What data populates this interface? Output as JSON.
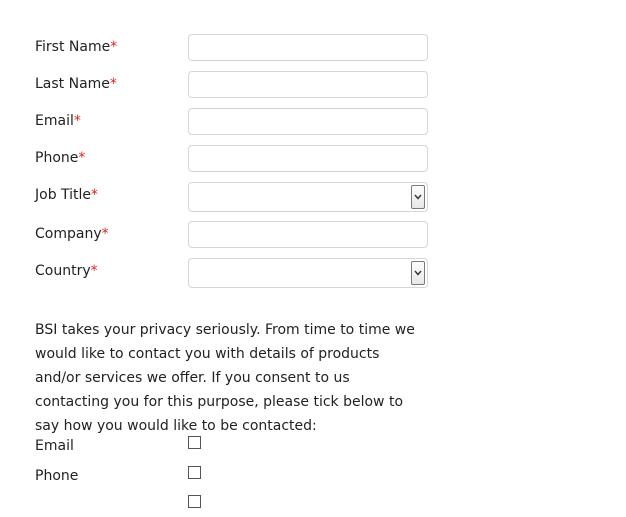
{
  "form": {
    "required_mark": "*",
    "fields": [
      {
        "label": "First Name",
        "value": "",
        "type": "text"
      },
      {
        "label": "Last Name",
        "value": "",
        "type": "text"
      },
      {
        "label": "Email",
        "value": "",
        "type": "text"
      },
      {
        "label": "Phone",
        "value": "",
        "type": "text"
      },
      {
        "label": "Job Title",
        "value": "",
        "type": "select"
      },
      {
        "label": "Company",
        "value": "",
        "type": "text"
      },
      {
        "label": "Country",
        "value": "",
        "type": "select"
      }
    ]
  },
  "privacy": {
    "text": "BSI takes your privacy seriously. From time to time we would like to contact you with details of products and/or services we offer. If you consent to us contacting you for this purpose, please tick below to say how you would like to be contacted:"
  },
  "contact_options": [
    {
      "label": "Email",
      "checked": false
    },
    {
      "label": "Phone",
      "checked": false
    },
    {
      "label": "",
      "checked": false
    }
  ],
  "colors": {
    "required": "#d9241b",
    "field_border": "#d6d6d6",
    "text": "#222222"
  },
  "icons": {
    "dropdown": "chevron-down-icon"
  }
}
